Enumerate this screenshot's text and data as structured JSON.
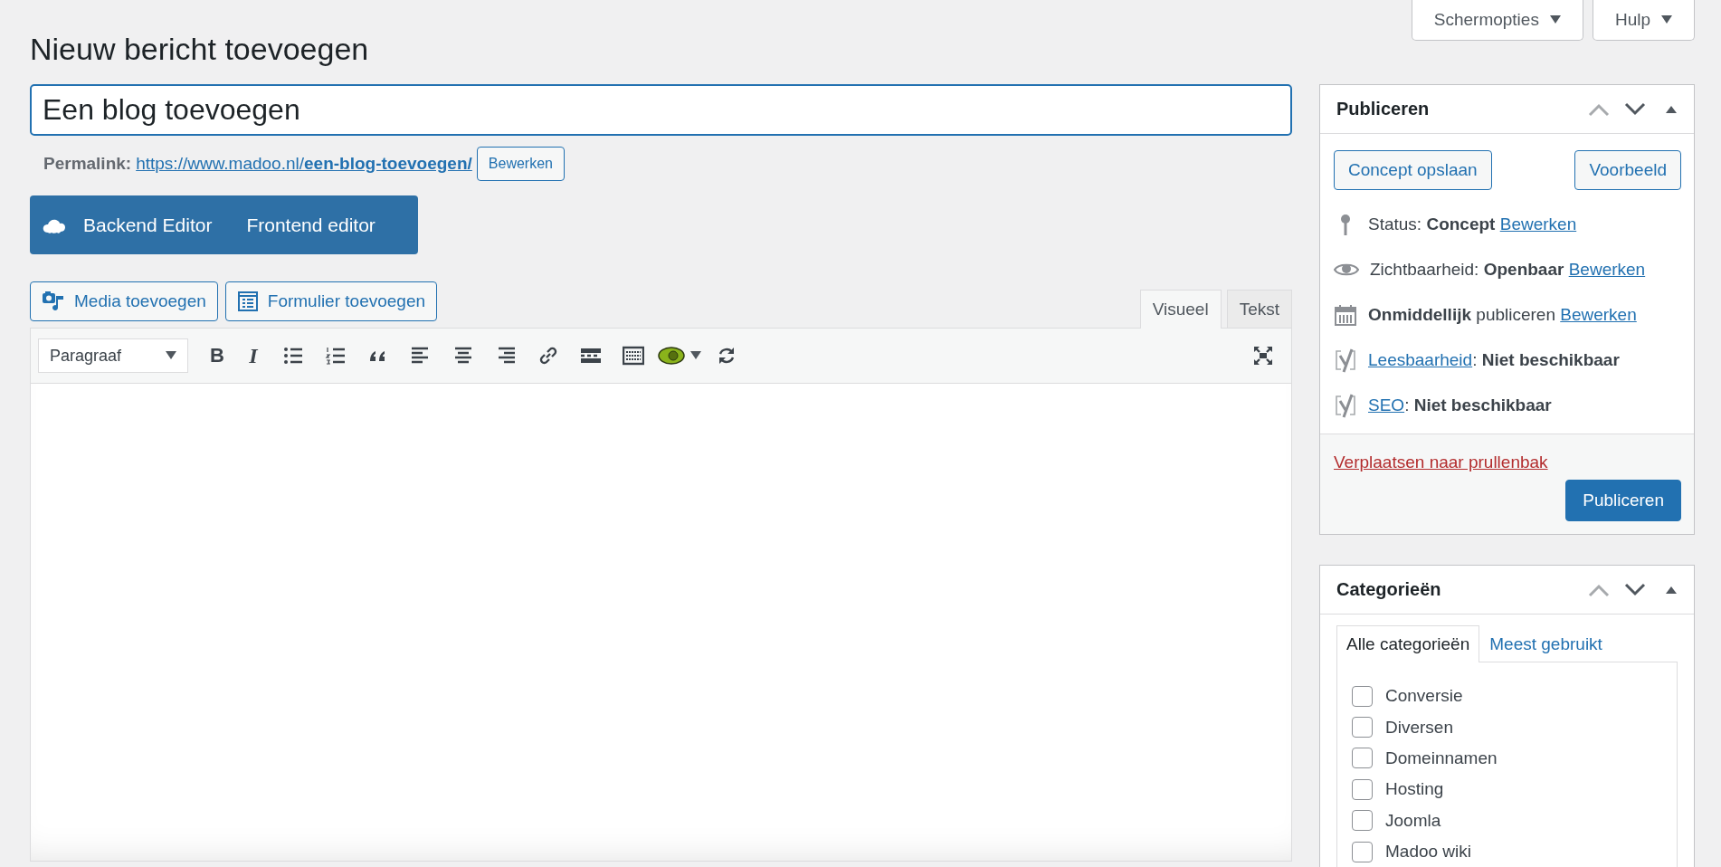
{
  "header_buttons": [
    {
      "label": "Schermopties"
    },
    {
      "label": "Hulp"
    }
  ],
  "page_title": "Nieuw bericht toevoegen",
  "post_title": {
    "value": "Een blog toevoegen"
  },
  "permalink": {
    "label": "Permalink:",
    "url": "https://www.madoo.nl/",
    "slug": "een-blog-toevoegen/",
    "button": "Bewerken"
  },
  "builder": {
    "buttons": [
      "Backend Editor",
      "Frontend editor"
    ]
  },
  "media_buttons": [
    {
      "label": "Media toevoegen",
      "kind": "media"
    },
    {
      "label": "Formulier toevoegen",
      "kind": "form"
    }
  ],
  "editor_tabs": [
    {
      "label": "Visueel",
      "selected": true
    },
    {
      "label": "Tekst",
      "selected": false
    }
  ],
  "toolbar": {
    "format": "Paragraaf",
    "bold": "B",
    "italic": "I"
  },
  "publish": {
    "title": "Publiceren",
    "buttons": [
      "Concept opslaan",
      "Voorbeeld"
    ],
    "rows": [
      {
        "kind": "status",
        "text": "Status: **Concept**",
        "link": "Bewerken"
      },
      {
        "kind": "visibility",
        "text": "Zichtbaarheid: **Openbaar**",
        "link": "Bewerken"
      },
      {
        "kind": "schedule",
        "text": "**Onmiddellijk** publiceren",
        "link": "Bewerken"
      },
      {
        "kind": "readability",
        "link": "Leesbaarheid",
        "text": ": **Niet beschikbaar**"
      },
      {
        "kind": "seo",
        "link": "SEO",
        "text": ": **Niet beschikbaar**"
      }
    ],
    "trash": "Verplaatsen naar prullenbak",
    "publish_button": "Publiceren"
  },
  "categories": {
    "title": "Categorieën",
    "tabs": [
      {
        "label": "Alle categorieën",
        "selected": true
      },
      {
        "label": "Meest gebruikt",
        "selected": false
      }
    ],
    "items": [
      {
        "label": "Conversie",
        "checked": false
      },
      {
        "label": "Diversen",
        "checked": false
      },
      {
        "label": "Domeinnamen",
        "checked": false
      },
      {
        "label": "Hosting",
        "checked": false
      },
      {
        "label": "Joomla",
        "checked": false
      },
      {
        "label": "Madoo wiki",
        "checked": false
      }
    ]
  }
}
